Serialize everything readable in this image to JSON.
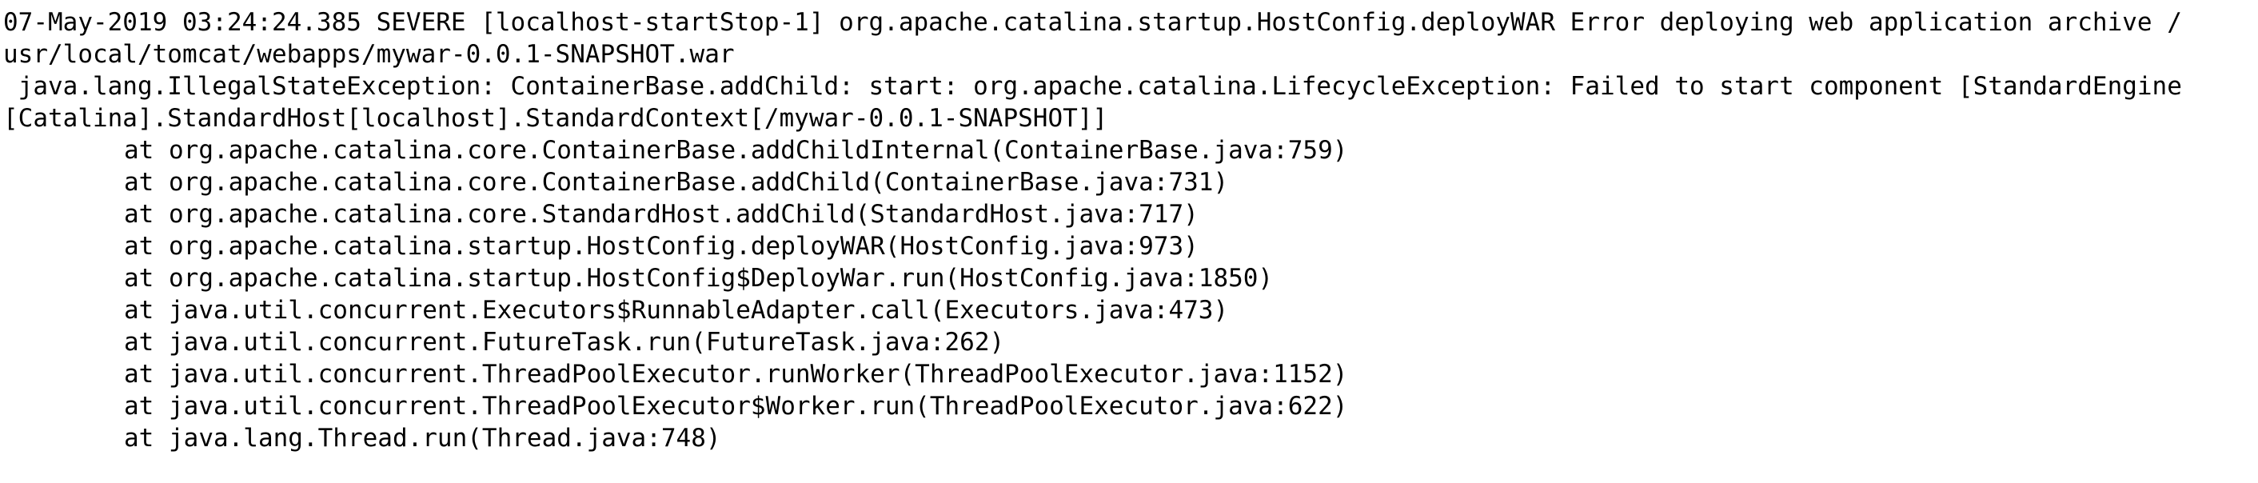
{
  "log": {
    "lines": [
      "07-May-2019 03:24:24.385 SEVERE [localhost-startStop-1] org.apache.catalina.startup.HostConfig.deployWAR Error deploying web application archive /",
      "usr/local/tomcat/webapps/mywar-0.0.1-SNAPSHOT.war",
      " java.lang.IllegalStateException: ContainerBase.addChild: start: org.apache.catalina.LifecycleException: Failed to start component [StandardEngine",
      "[Catalina].StandardHost[localhost].StandardContext[/mywar-0.0.1-SNAPSHOT]]"
    ],
    "stack_frames": [
      "at org.apache.catalina.core.ContainerBase.addChildInternal(ContainerBase.java:759)",
      "at org.apache.catalina.core.ContainerBase.addChild(ContainerBase.java:731)",
      "at org.apache.catalina.core.StandardHost.addChild(StandardHost.java:717)",
      "at org.apache.catalina.startup.HostConfig.deployWAR(HostConfig.java:973)",
      "at org.apache.catalina.startup.HostConfig$DeployWar.run(HostConfig.java:1850)",
      "at java.util.concurrent.Executors$RunnableAdapter.call(Executors.java:473)",
      "at java.util.concurrent.FutureTask.run(FutureTask.java:262)",
      "at java.util.concurrent.ThreadPoolExecutor.runWorker(ThreadPoolExecutor.java:1152)",
      "at java.util.concurrent.ThreadPoolExecutor$Worker.run(ThreadPoolExecutor.java:622)",
      "at java.lang.Thread.run(Thread.java:748)"
    ]
  }
}
